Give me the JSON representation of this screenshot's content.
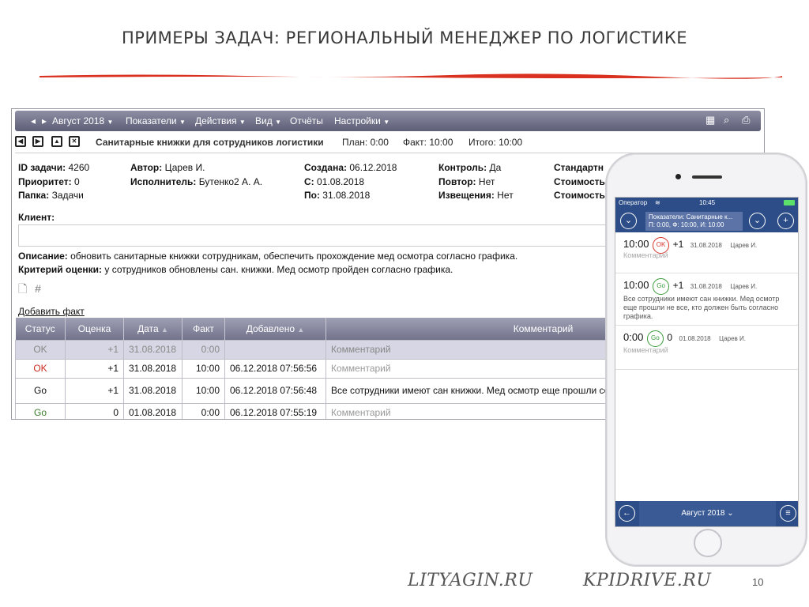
{
  "slide": {
    "title": "ПРИМЕРЫ ЗАДАЧ: РЕГИОНАЛЬНЫЙ МЕНЕДЖЕР ПО ЛОГИСТИКЕ",
    "footer_left": "LITYAGIN.RU",
    "footer_right": "KPIDRIVE.RU",
    "page_number": "10",
    "accent_color": "#d9301f"
  },
  "menu": {
    "month": "Август 2018",
    "items": [
      "Показатели",
      "Действия",
      "Вид",
      "Отчёты",
      "Настройки"
    ],
    "icons": [
      "grid-icon",
      "search-icon",
      "print-icon"
    ]
  },
  "task": {
    "title": "Санитарные книжки для сотрудников логистики",
    "plan": "План: 0:00",
    "fact": "Факт: 10:00",
    "total": "Итого: 10:00",
    "fields": {
      "id_label": "ID задачи:",
      "id": "4260",
      "priority_label": "Приоритет:",
      "priority": "0",
      "folder_label": "Папка:",
      "folder": "Задачи",
      "author_label": "Автор:",
      "author": "Царев И.",
      "executor_label": "Исполнитель:",
      "executor": "Бутенко2 А. А.",
      "created_label": "Создана:",
      "created": "06.12.2018",
      "from_label": "С:",
      "from": "01.08.2018",
      "to_label": "По:",
      "to": "31.08.2018",
      "control_label": "Контроль:",
      "control": "Да",
      "repeat_label": "Повтор:",
      "repeat": "Нет",
      "notify_label": "Извещения:",
      "notify": "Нет",
      "standard_label": "Стандартн",
      "cost1_label": "Стоимость",
      "cost2_label": "Стоимость"
    },
    "client_label": "Клиент:",
    "description_label": "Описание:",
    "description": "обновить санитарные книжки сотрудникам, обеспечить прохождение мед осмотра согласно графика.",
    "criterion_label": "Критерий оценки:",
    "criterion": "у сотрудников обновлены сан. книжки. Мед осмотр пройден согласно графика.",
    "add_fact": "Добавить факт"
  },
  "table": {
    "columns": [
      "Статус",
      "Оценка",
      "Дата",
      "Факт",
      "Добавлено",
      "Комментарий"
    ],
    "rows": [
      {
        "status": "OK",
        "score": "+1",
        "date": "31.08.2018",
        "fact": "0:00",
        "added": "",
        "comment": "Комментарий"
      },
      {
        "status": "OK",
        "score": "+1",
        "date": "31.08.2018",
        "fact": "10:00",
        "added": "06.12.2018 07:56:56",
        "comment": "Комментарий"
      },
      {
        "status": "Go",
        "score": "+1",
        "date": "31.08.2018",
        "fact": "10:00",
        "added": "06.12.2018 07:56:48",
        "comment": "Все сотрудники имеют сан книжки. Мед осмотр еще прошли согласно графика."
      },
      {
        "status": "Go",
        "score": "0",
        "date": "01.08.2018",
        "fact": "0:00",
        "added": "06.12.2018 07:55:19",
        "comment": "Комментарий"
      }
    ]
  },
  "phone": {
    "carrier": "Оператор",
    "time": "10:45",
    "header_line1": "Показатели: Санитарные к...",
    "header_line2": "П: 0:00, Ф: 10:00, И: 10:00",
    "items": [
      {
        "value": "10:00",
        "status": "OK",
        "delta": "+1",
        "date": "31.08.2018",
        "author": "Царев И.",
        "comment": "Комментарий"
      },
      {
        "value": "10:00",
        "status": "Go",
        "delta": "+1",
        "date": "31.08.2018",
        "author": "Царев И.",
        "comment": "Все сотрудники имеют сан книжки. Мед осмотр еще прошли не все, кто должен быть согласно графика."
      },
      {
        "value": "0:00",
        "status": "Go",
        "delta": "0",
        "date": "01.08.2018",
        "author": "Царев И.",
        "comment": "Комментарий"
      }
    ],
    "footer_month": "Август 2018"
  }
}
